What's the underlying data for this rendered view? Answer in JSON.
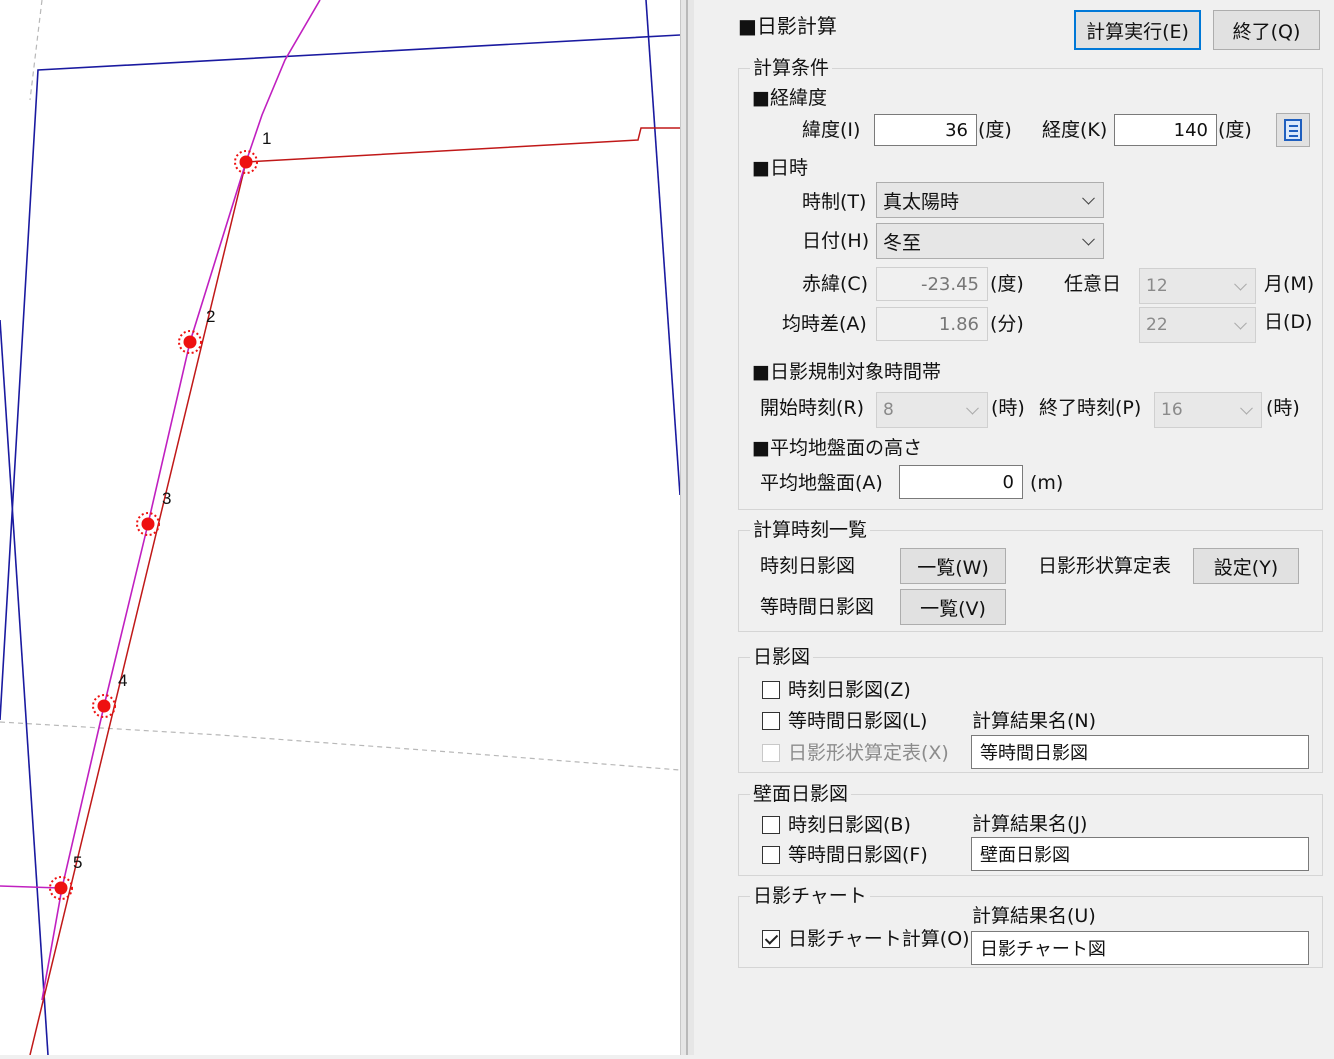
{
  "canvas": {
    "points": [
      {
        "label": "1"
      },
      {
        "label": "2"
      },
      {
        "label": "3"
      },
      {
        "label": "4"
      },
      {
        "label": "5"
      }
    ],
    "colors": {
      "building": "#1a1aa0",
      "road": "#c01818",
      "shadow_line": "#c020c0",
      "point": "#ee1111",
      "guide": "#b8b8b8"
    }
  },
  "panel": {
    "title": "■日影計算",
    "buttons": {
      "run": "計算実行(E)",
      "exit": "終了(Q)"
    },
    "calc_conditions": {
      "group_title": "計算条件",
      "latlon": {
        "heading": "■経緯度",
        "lat_label": "緯度(I)",
        "lat_value": "36",
        "lat_unit": "(度)",
        "lon_label": "経度(K)",
        "lon_value": "140",
        "lon_unit": "(度)",
        "picker_icon": "document-list-icon"
      },
      "datetime": {
        "heading": "■日時",
        "timesystem_label": "時制(T)",
        "timesystem_value": "真太陽時",
        "date_label": "日付(H)",
        "date_value": "冬至",
        "declination_label": "赤緯(C)",
        "declination_value": "-23.45",
        "declination_unit": "(度)",
        "anyday_label": "任意日",
        "month_value": "12",
        "month_unit": "月(M)",
        "eot_label": "均時差(A)",
        "eot_value": "1.86",
        "eot_unit": "(分)",
        "day_value": "22",
        "day_unit": "日(D)"
      },
      "time_band": {
        "heading": "■日影規制対象時間帯",
        "start_label": "開始時刻(R)",
        "start_value": "8",
        "start_unit": "(時)",
        "end_label": "終了時刻(P)",
        "end_value": "16",
        "end_unit": "(時)"
      },
      "ground": {
        "heading": "■平均地盤面の高さ",
        "label": "平均地盤面(A)",
        "value": "0",
        "unit": "(m)"
      }
    },
    "time_list": {
      "group_title": "計算時刻一覧",
      "time_shadow_label": "時刻日影図",
      "time_shadow_button": "一覧(W)",
      "shape_table_label": "日影形状算定表",
      "shape_table_button": "設定(Y)",
      "equal_time_label": "等時間日影図",
      "equal_time_button": "一覧(V)"
    },
    "shadow_map": {
      "group_title": "日影図",
      "cb_time": {
        "label": "時刻日影図(Z)",
        "checked": false
      },
      "cb_equal": {
        "label": "等時間日影図(L)",
        "checked": false
      },
      "cb_shape": {
        "label": "日影形状算定表(X)",
        "checked": false,
        "enabled": false
      },
      "result_label": "計算結果名(N)",
      "result_value": "等時間日影図"
    },
    "wall_shadow": {
      "group_title": "壁面日影図",
      "cb_time": {
        "label": "時刻日影図(B)",
        "checked": false
      },
      "cb_equal": {
        "label": "等時間日影図(F)",
        "checked": false
      },
      "result_label": "計算結果名(J)",
      "result_value": "壁面日影図"
    },
    "shadow_chart": {
      "group_title": "日影チャート",
      "cb_calc": {
        "label": "日影チャート計算(O)",
        "checked": true
      },
      "result_label": "計算結果名(U)",
      "result_value": "日影チャート図"
    }
  }
}
